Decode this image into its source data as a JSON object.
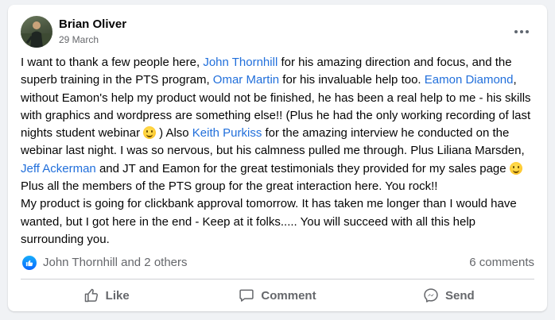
{
  "post": {
    "author": "Brian Oliver",
    "date": "29 March",
    "body": {
      "p1_a": "I want to thank a few people here, ",
      "mention_1": "John Thornhill",
      "p1_b": " for his amazing direction and focus, and the superb training in the PTS program, ",
      "mention_2": "Omar Martin",
      "p1_c": " for his invaluable help too. ",
      "mention_3": "Eamon Diamond",
      "p1_d": ", without Eamon's help my product would not be finished, he has been a real help to me - his skills with graphics and wordpress are something else!! (Plus he had the only working recording of last nights student webinar",
      "p1_e": ") Also ",
      "mention_4": "Keith Purkiss",
      "p1_f": " for the amazing interview he conducted on the webinar last night. I was so nervous, but his calmness pulled me through. Plus Liliana Marsden, ",
      "mention_5": "Jeff Ackerman",
      "p1_g": " and JT and Eamon for the great testimonials they provided for my sales page",
      "p2": "Plus all the members of the PTS group for the great interaction here. You rock!!",
      "p3": "My product is going for clickbank approval tomorrow. It has taken me longer than I would have wanted, but I got here in the end - Keep at it folks..... You will succeed with all this help surrounding you."
    }
  },
  "stats": {
    "reactors": "John Thornhill and 2 others",
    "comments": "6 comments"
  },
  "actions": {
    "like": "Like",
    "comment": "Comment",
    "send": "Send"
  },
  "icons": {
    "more": "more-options-icon",
    "like_badge": "like-reaction-icon",
    "emoji": "smiley-emoji-icon",
    "like": "thumbs-up-icon",
    "comment": "comment-bubble-icon",
    "send": "messenger-icon"
  },
  "colors": {
    "mention": "#216fdb",
    "secondary_text": "#65676b",
    "like_blue": "#0866ff"
  }
}
